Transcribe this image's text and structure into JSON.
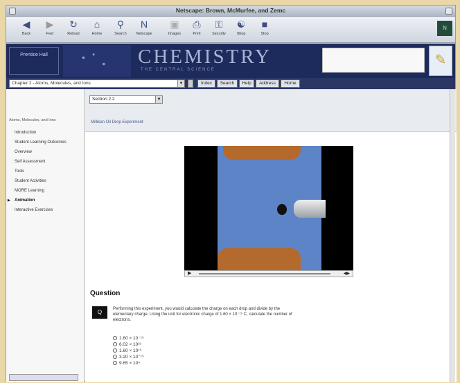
{
  "window": {
    "title": "Netscape: Brown, McMurfee, and Zemc"
  },
  "toolbar": {
    "buttons": [
      {
        "label": "Back",
        "icon": "back-arrow-icon"
      },
      {
        "label": "Fwd",
        "icon": "forward-arrow-icon"
      },
      {
        "label": "Reload",
        "icon": "reload-icon"
      },
      {
        "label": "Home",
        "icon": "home-icon"
      },
      {
        "label": "Search",
        "icon": "search-icon"
      },
      {
        "label": "Netscape",
        "icon": "netscape-icon"
      },
      {
        "label": "Images",
        "icon": "images-icon"
      },
      {
        "label": "Print",
        "icon": "print-icon"
      },
      {
        "label": "Security",
        "icon": "security-icon"
      },
      {
        "label": "Shop",
        "icon": "shop-icon"
      },
      {
        "label": "Stop",
        "icon": "stop-icon"
      }
    ]
  },
  "banner": {
    "brand": "Prentice Hall",
    "title": "CHEMISTRY",
    "subtitle": "THE CENTRAL SCIENCE"
  },
  "nav": {
    "selected": "Chapter 2 - Atoms, Molecules, and Ions",
    "tabs": [
      "Index",
      "Search",
      "Help",
      "Address",
      "Home"
    ]
  },
  "content": {
    "section_dropdown": "Section 2.2",
    "breadcrumb": "Millikan Oil Drop Experiment"
  },
  "sidebar": {
    "heading": "Atoms, Molecules, and Ions",
    "items": [
      "Introduction",
      "Student Learning Outcomes",
      "Overview",
      "Self Assessment",
      "Tools",
      "Student Activities",
      "MORE Learning",
      "Animation",
      "Interactive Exercises"
    ]
  },
  "question": {
    "title": "Question",
    "icon_label": "Q",
    "text": "Performing this experiment, you would calculate the charge on each drop and divide by the elementary charge. Using the unit for electronic charge of 1.60 × 10⁻¹⁹ C, calculate the number of electrons.",
    "choices": [
      "1.60 × 10⁻¹⁹",
      "6.02 × 10²³",
      "1.60 × 10¹⁹",
      "3.20 × 10⁻¹⁹",
      "9.65 × 10⁴"
    ]
  },
  "colors": {
    "banner": "#1d2a5c",
    "accent_tan": "#e9d7a8",
    "video_blue": "#5d84c6"
  }
}
